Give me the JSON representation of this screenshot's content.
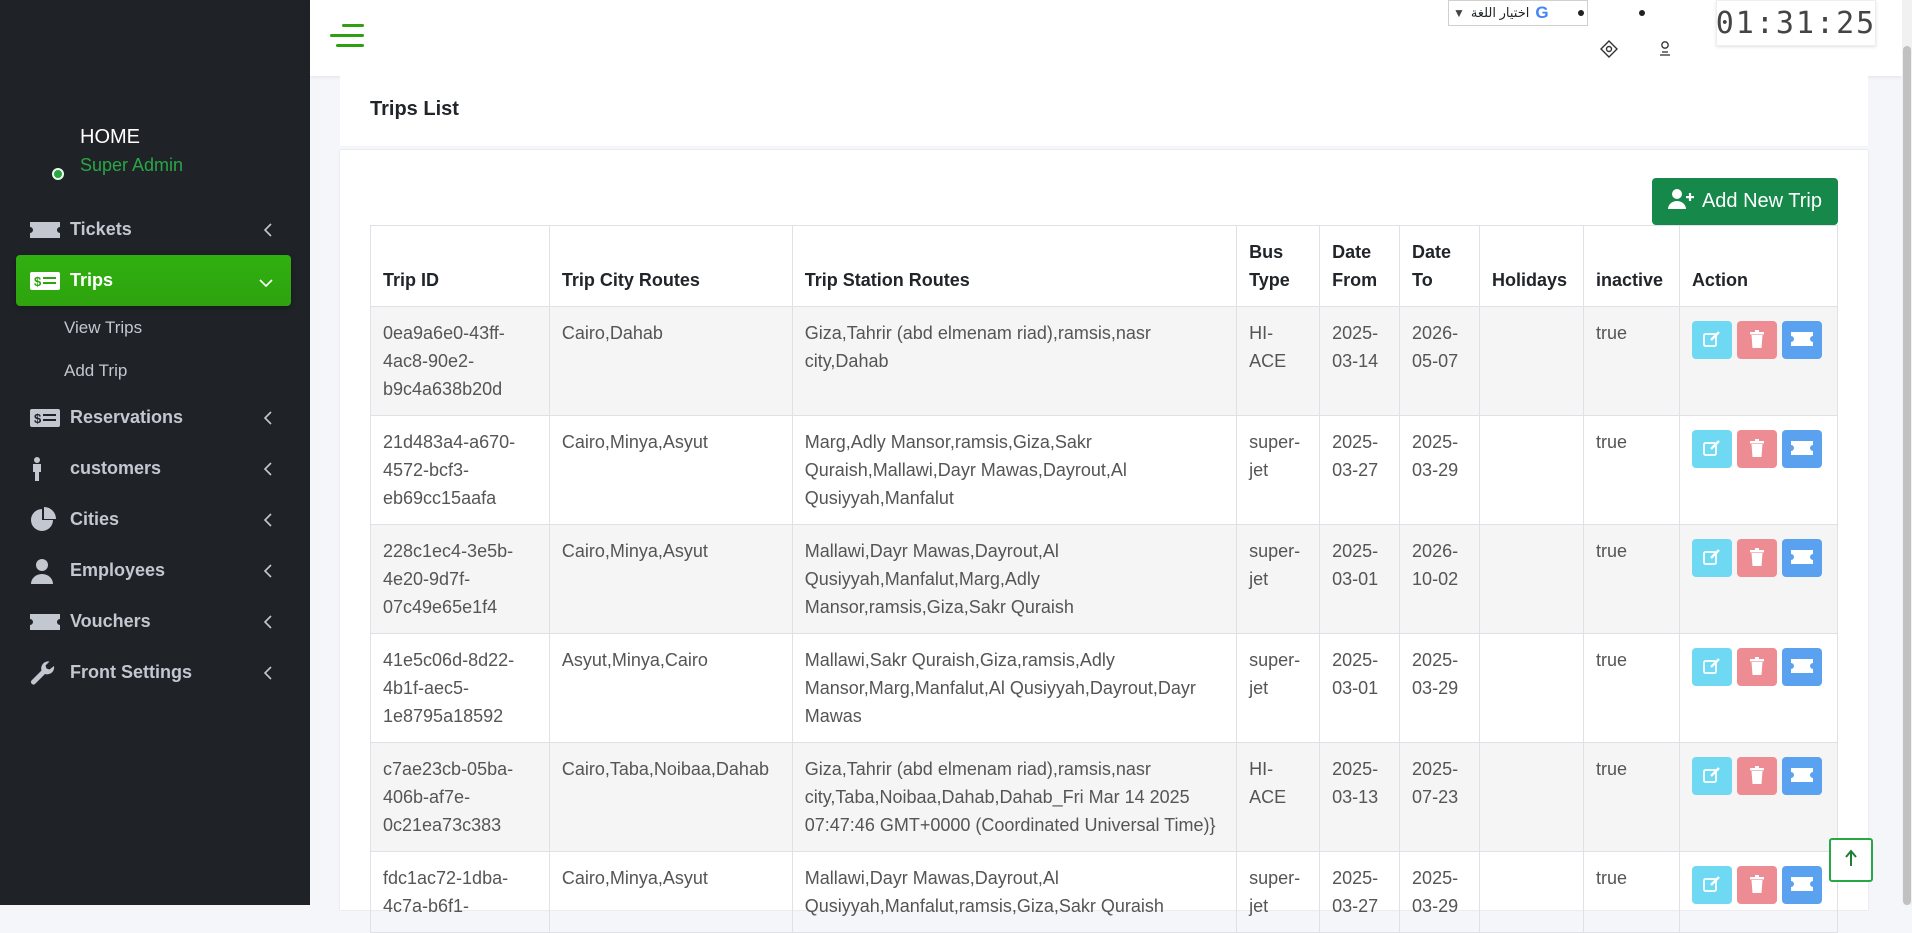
{
  "sidebar": {
    "user": {
      "name": "HOME",
      "role": "Super Admin"
    },
    "items": [
      {
        "label": "Tickets"
      },
      {
        "label": "Trips",
        "sub": [
          "View Trips",
          "Add Trip"
        ]
      },
      {
        "label": "Reservations"
      },
      {
        "label": "customers"
      },
      {
        "label": "Cities"
      },
      {
        "label": "Employees"
      },
      {
        "label": "Vouchers"
      },
      {
        "label": "Front Settings"
      }
    ]
  },
  "topbar": {
    "language_label": "اختيار اللغة",
    "language_letter": "G",
    "clock": "01:31:25"
  },
  "page": {
    "title": "Trips List",
    "add_button": "Add New Trip"
  },
  "table": {
    "headers": [
      "Trip ID",
      "Trip City Routes",
      "Trip Station Routes",
      "Bus Type",
      "Date From",
      "Date To",
      "Holidays",
      "inactive",
      "Action"
    ],
    "rows": [
      {
        "id": "0ea9a6e0-43ff-4ac8-90e2-b9c4a638b20d",
        "cities": "Cairo,Dahab",
        "stations": "Giza,Tahrir (abd elmenam riad),ramsis,nasr city,Dahab",
        "bus": "HI-ACE",
        "from": "2025-03-14",
        "to": "2026-05-07",
        "holidays": "",
        "inactive": "true"
      },
      {
        "id": "21d483a4-a670-4572-bcf3-eb69cc15aafa",
        "cities": "Cairo,Minya,Asyut",
        "stations": "Marg,Adly Mansor,ramsis,Giza,Sakr Quraish,Mallawi,Dayr Mawas,Dayrout,Al Qusiyyah,Manfalut",
        "bus": "super-jet",
        "from": "2025-03-27",
        "to": "2025-03-29",
        "holidays": "",
        "inactive": "true"
      },
      {
        "id": "228c1ec4-3e5b-4e20-9d7f-07c49e65e1f4",
        "cities": "Cairo,Minya,Asyut",
        "stations": "Mallawi,Dayr Mawas,Dayrout,Al Qusiyyah,Manfalut,Marg,Adly Mansor,ramsis,Giza,Sakr Quraish",
        "bus": "super-jet",
        "from": "2025-03-01",
        "to": "2026-10-02",
        "holidays": "",
        "inactive": "true"
      },
      {
        "id": "41e5c06d-8d22-4b1f-aec5-1e8795a18592",
        "cities": "Asyut,Minya,Cairo",
        "stations": "Mallawi,Sakr Quraish,Giza,ramsis,Adly Mansor,Marg,Manfalut,Al Qusiyyah,Dayrout,Dayr Mawas",
        "bus": "super-jet",
        "from": "2025-03-01",
        "to": "2025-03-29",
        "holidays": "",
        "inactive": "true"
      },
      {
        "id": "c7ae23cb-05ba-406b-af7e-0c21ea73c383",
        "cities": "Cairo,Taba,Noibaa,Dahab",
        "stations": "Giza,Tahrir (abd elmenam riad),ramsis,nasr city,Taba,Noibaa,Dahab,Dahab_Fri Mar 14 2025 07:47:46 GMT+0000 (Coordinated Universal Time)}",
        "bus": "HI-ACE",
        "from": "2025-03-13",
        "to": "2025-07-23",
        "holidays": "",
        "inactive": "true"
      },
      {
        "id": "fdc1ac72-1dba-4c7a-b6f1-",
        "cities": "Cairo,Minya,Asyut",
        "stations": "Mallawi,Dayr Mawas,Dayrout,Al Qusiyyah,Manfalut,ramsis,Giza,Sakr Quraish",
        "bus": "super-jet",
        "from": "2025-03-27",
        "to": "2025-03-29",
        "holidays": "",
        "inactive": "true"
      }
    ]
  },
  "colors": {
    "sidebar_bg": "#1f2327",
    "active_green": "#28a745",
    "add_button": "#16884a",
    "edit": "#6fd8f3",
    "delete": "#ee8c94",
    "ticket": "#5aa2f0"
  },
  "icons": {
    "edit": "edit-icon",
    "delete": "trash-icon",
    "ticket": "ticket-icon",
    "add": "user-plus-icon",
    "scroll": "arrow-up-icon"
  }
}
